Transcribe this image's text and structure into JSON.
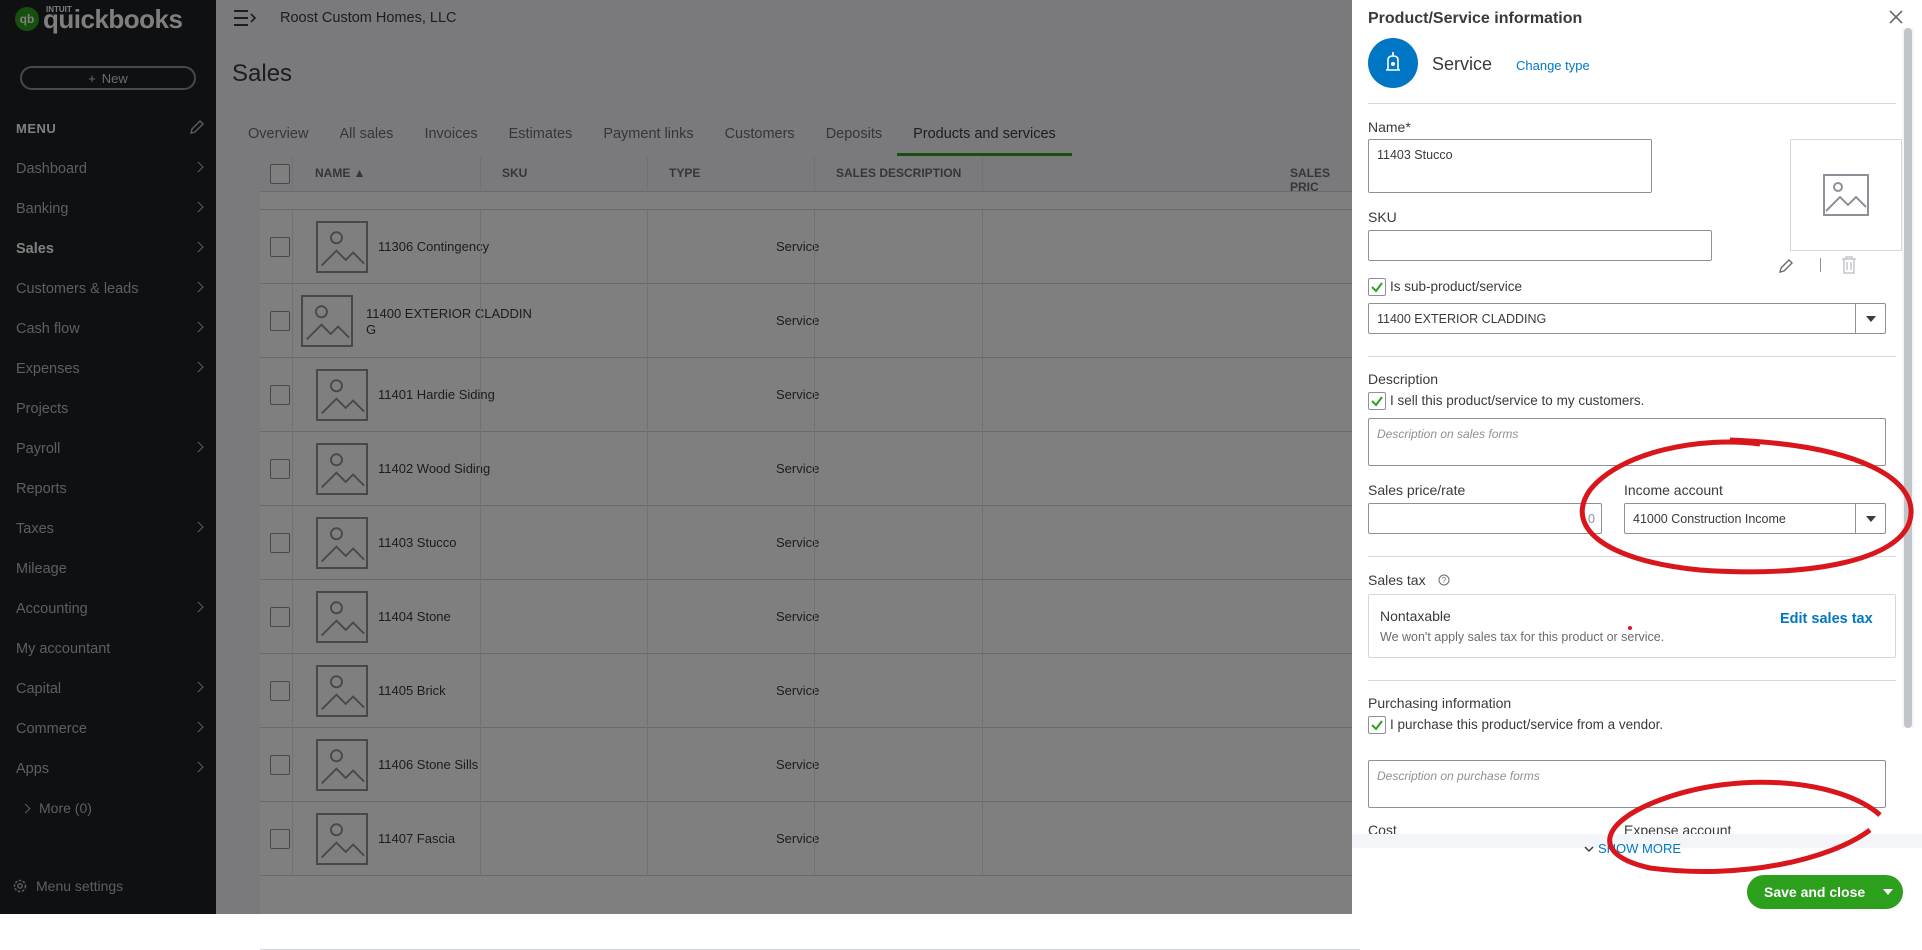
{
  "sidebar": {
    "logo_intuit": "INTUIT",
    "logo_text": "quickbooks",
    "logo_badge": "qb",
    "new_label": "New",
    "new_plus": "+",
    "menu_heading": "MENU",
    "items": [
      {
        "label": "Dashboard",
        "chevron": true
      },
      {
        "label": "Banking",
        "chevron": true
      },
      {
        "label": "Sales",
        "chevron": true,
        "active": true
      },
      {
        "label": "Customers & leads",
        "chevron": true
      },
      {
        "label": "Cash flow",
        "chevron": true
      },
      {
        "label": "Expenses",
        "chevron": true
      },
      {
        "label": "Projects",
        "chevron": false
      },
      {
        "label": "Payroll",
        "chevron": true
      },
      {
        "label": "Reports",
        "chevron": false
      },
      {
        "label": "Taxes",
        "chevron": true
      },
      {
        "label": "Mileage",
        "chevron": false
      },
      {
        "label": "Accounting",
        "chevron": true
      },
      {
        "label": "My accountant",
        "chevron": false
      },
      {
        "label": "Capital",
        "chevron": true
      },
      {
        "label": "Commerce",
        "chevron": true
      },
      {
        "label": "Apps",
        "chevron": true
      }
    ],
    "more_label": "More (0)",
    "menu_settings_label": "Menu settings"
  },
  "header": {
    "company": "Roost Custom Homes, LLC",
    "page_title": "Sales"
  },
  "tabs": [
    {
      "label": "Overview",
      "active": false
    },
    {
      "label": "All sales",
      "active": false
    },
    {
      "label": "Invoices",
      "active": false
    },
    {
      "label": "Estimates",
      "active": false
    },
    {
      "label": "Payment links",
      "active": false
    },
    {
      "label": "Customers",
      "active": false
    },
    {
      "label": "Deposits",
      "active": false
    },
    {
      "label": "Products and services",
      "active": true
    }
  ],
  "table": {
    "columns": [
      "NAME ▲",
      "SKU",
      "TYPE",
      "SALES DESCRIPTION",
      "SALES PRIC"
    ],
    "rows": [
      {
        "name": "11306 Contingency",
        "type": "Service",
        "indent": true
      },
      {
        "name": "11400 EXTERIOR CLADDIN",
        "name2": "G",
        "type": "Service",
        "indent": false
      },
      {
        "name": "11401 Hardie Siding",
        "type": "Service",
        "indent": true
      },
      {
        "name": "11402 Wood Siding",
        "type": "Service",
        "indent": true
      },
      {
        "name": "11403 Stucco",
        "type": "Service",
        "indent": true
      },
      {
        "name": "11404 Stone",
        "type": "Service",
        "indent": true
      },
      {
        "name": "11405 Brick",
        "type": "Service",
        "indent": true
      },
      {
        "name": "11406 Stone Sills",
        "type": "Service",
        "indent": true
      },
      {
        "name": "11407 Fascia",
        "type": "Service",
        "indent": true
      }
    ]
  },
  "panel": {
    "title": "Product/Service information",
    "type_label": "Service",
    "change_type": "Change type",
    "name_label": "Name*",
    "name_value": "11403 Stucco",
    "sku_label": "SKU",
    "sku_value": "",
    "sub_product_label": "Is sub-product/service",
    "sub_product_checked": true,
    "parent_value": "11400  EXTERIOR CLADDING",
    "description_label": "Description",
    "sell_label": "I sell this product/service to my customers.",
    "sell_checked": true,
    "sales_desc_placeholder": "Description on sales forms",
    "sales_price_label": "Sales price/rate",
    "sales_price_value": "",
    "sales_price_fragment": "0",
    "income_account_label": "Income account",
    "income_account_value": "41000 Construction Income",
    "sales_tax_label": "Sales tax",
    "tax_status": "Nontaxable",
    "tax_note": "We won't apply sales tax for this product or service.",
    "edit_sales_tax": "Edit sales tax",
    "purchasing_label": "Purchasing information",
    "purchase_label": "I purchase this product/service from a vendor.",
    "purchase_checked": true,
    "purchase_desc_placeholder": "Description on purchase forms",
    "cost_label": "Cost",
    "expense_account_label": "Expense account",
    "show_more": "SHOW MORE",
    "save_close": "Save and close"
  },
  "colors": {
    "brand_green": "#2ca01c",
    "link_blue": "#0077c5",
    "sidebar_bg": "#1f2024",
    "annotation_red": "#d8161b"
  }
}
